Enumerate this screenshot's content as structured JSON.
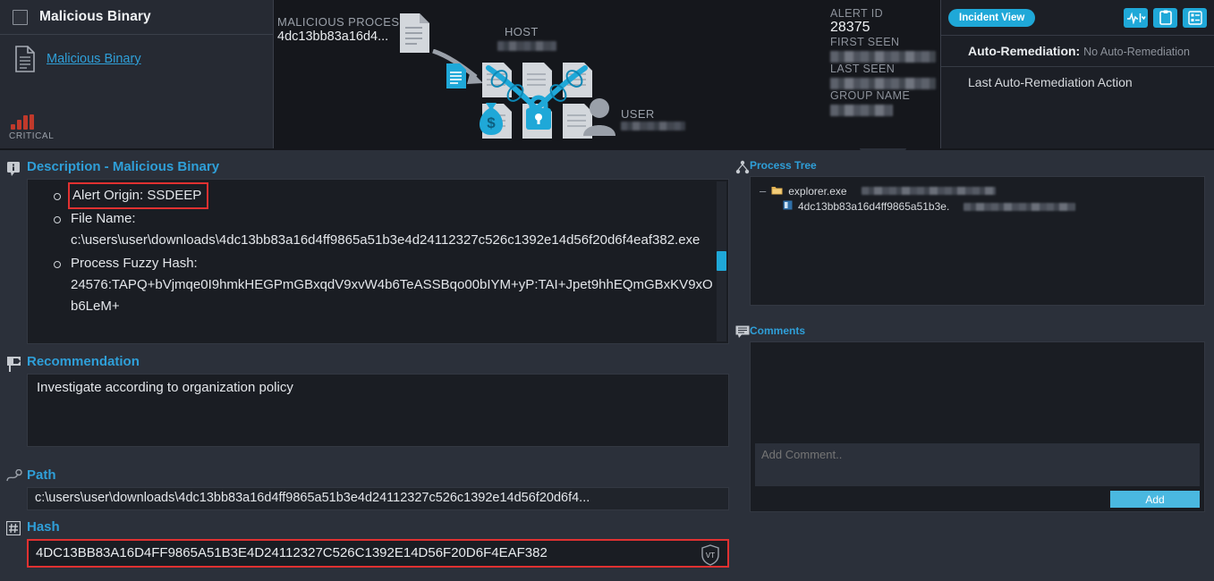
{
  "alert_card": {
    "title": "Malicious Binary",
    "link_label": "Malicious Binary",
    "severity": "CRITICAL",
    "severity_color": "#c0392b",
    "checkbox_checked": false
  },
  "diagram": {
    "process_label": "MALICIOUS PROCESS",
    "process_value": "4dc13bb83a16d4...",
    "host_label": "HOST",
    "host_value_redacted": true,
    "user_label": "USER",
    "user_value_redacted": true,
    "expand_arrows": "↑↑↑"
  },
  "alert_meta": {
    "fields": [
      {
        "label": "ALERT ID",
        "value": "28375",
        "redacted": false
      },
      {
        "label": "FIRST SEEN",
        "value": "",
        "redacted": true
      },
      {
        "label": "LAST SEEN",
        "value": "",
        "redacted": true
      },
      {
        "label": "GROUP NAME",
        "value": "",
        "redacted": true
      }
    ]
  },
  "incident_panel": {
    "view_button": "Incident View",
    "icons": [
      {
        "name": "activity-dropdown-icon"
      },
      {
        "name": "clipboard-icon"
      },
      {
        "name": "list-icon"
      }
    ],
    "auto_remediation_label": "Auto-Remediation:",
    "auto_remediation_value": "No Auto-Remediation",
    "last_action_label": "Last Auto-Remediation Action",
    "accent_color": "#1fa8d8"
  },
  "description": {
    "heading": "Description - Malicious Binary",
    "items": [
      {
        "label": "Alert Origin: SSDEEP",
        "value": "",
        "highlighted": true
      },
      {
        "label": "File Name:",
        "value": "c:\\users\\user\\downloads\\4dc13bb83a16d4ff9865a51b3e4d24112327c526c1392e14d56f20d6f4eaf382.exe",
        "highlighted": false
      },
      {
        "label": "Process Fuzzy Hash:",
        "value": "24576:TAPQ+bVjmqe0I9hmkHEGPmGBxqdV9xvW4b6TeASSBqo00bIYM+yP:TAI+Jpet9hhEQmGBxKV9xOb6LeM+",
        "highlighted": false
      }
    ],
    "highlight_color": "#e03131"
  },
  "recommendation": {
    "heading": "Recommendation",
    "text": "Investigate according to organization policy"
  },
  "path": {
    "heading": "Path",
    "value": "c:\\users\\user\\downloads\\4dc13bb83a16d4ff9865a51b3e4d24112327c526c1392e14d56f20d6f4..."
  },
  "hash": {
    "heading": "Hash",
    "value": "4DC13BB83A16D4FF9865A51B3E4D24112327C526C1392E14D56F20D6F4EAF382",
    "vt_badge": "VT",
    "highlight_color": "#e03131"
  },
  "process_tree": {
    "heading": "Process Tree",
    "nodes": [
      {
        "name": "explorer.exe",
        "icon": "folder-icon",
        "depth": 0,
        "collapsible": true,
        "redacted_detail": true
      },
      {
        "name": "4dc13bb83a16d4ff9865a51b3e.",
        "icon": "binary-icon",
        "depth": 1,
        "collapsible": false,
        "redacted_detail": true
      }
    ]
  },
  "comments": {
    "heading": "Comments",
    "placeholder": "Add Comment..",
    "value": "",
    "add_button": "Add"
  }
}
